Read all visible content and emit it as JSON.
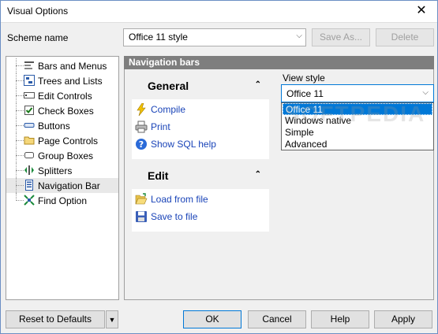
{
  "window": {
    "title": "Visual Options",
    "close_glyph": "✕"
  },
  "scheme": {
    "label": "Scheme name",
    "value": "Office 11 style",
    "save_as_label": "Save As...",
    "delete_label": "Delete"
  },
  "tree": {
    "items": [
      {
        "label": "Bars and Menus",
        "icon": "bars-menus-icon"
      },
      {
        "label": "Trees and Lists",
        "icon": "trees-lists-icon"
      },
      {
        "label": "Edit Controls",
        "icon": "edit-controls-icon"
      },
      {
        "label": "Check Boxes",
        "icon": "check-box-icon"
      },
      {
        "label": "Buttons",
        "icon": "button-icon"
      },
      {
        "label": "Page Controls",
        "icon": "folder-tab-icon"
      },
      {
        "label": "Group Boxes",
        "icon": "group-box-icon"
      },
      {
        "label": "Splitters",
        "icon": "splitter-icon"
      },
      {
        "label": "Navigation Bar",
        "icon": "navigation-bar-icon",
        "selected": true
      },
      {
        "label": "Find Option",
        "icon": "find-option-icon"
      }
    ]
  },
  "panel": {
    "header": "Navigation bars",
    "groups": [
      {
        "title": "General",
        "collapse_glyph": "⌃",
        "links": [
          {
            "label": "Compile",
            "icon": "lightning-icon"
          },
          {
            "label": "Print",
            "icon": "printer-icon"
          },
          {
            "label": "Show SQL help",
            "icon": "help-icon"
          }
        ]
      },
      {
        "title": "Edit",
        "collapse_glyph": "⌃",
        "links": [
          {
            "label": "Load from file",
            "icon": "folder-open-icon"
          },
          {
            "label": "Save to file",
            "icon": "floppy-disk-icon"
          }
        ]
      }
    ],
    "view_style": {
      "label": "View style",
      "value": "Office 11",
      "options": [
        "Office 11",
        "Windows native",
        "Simple",
        "Advanced"
      ],
      "selected_index": 0
    },
    "watermark": "SOFTPEDIA"
  },
  "footer": {
    "reset_label": "Reset to Defaults",
    "ok_label": "OK",
    "cancel_label": "Cancel",
    "help_label": "Help",
    "apply_label": "Apply"
  },
  "colors": {
    "link": "#1a44b8",
    "selection": "#0078d7",
    "header_bg": "#7e7e7e"
  }
}
